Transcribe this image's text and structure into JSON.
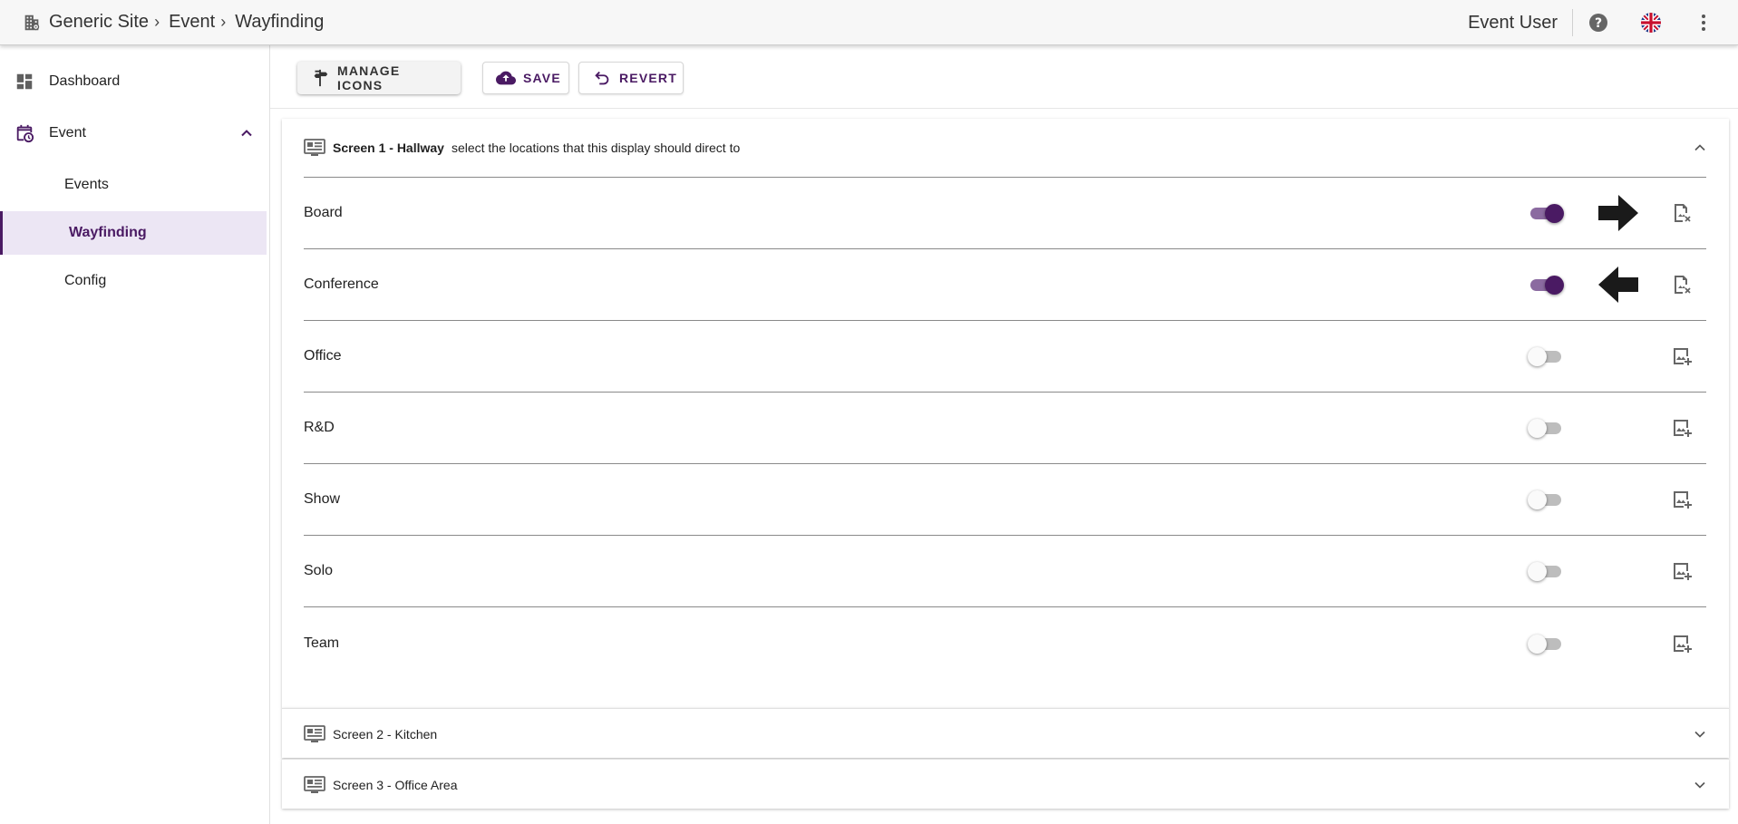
{
  "breadcrumb": {
    "items": [
      "Generic Site",
      "Event",
      "Wayfinding"
    ],
    "separator": "›"
  },
  "header": {
    "user_name": "Event User",
    "help_icon": "help-circle-icon",
    "language_icon": "uk-flag-icon",
    "menu_icon": "more-vert-icon"
  },
  "sidebar": {
    "items": [
      {
        "label": "Dashboard",
        "icon": "dashboard-icon"
      },
      {
        "label": "Event",
        "icon": "calendar-clock-icon",
        "expanded": true
      },
      {
        "label": "Events"
      },
      {
        "label": "Wayfinding",
        "active": true
      },
      {
        "label": "Config"
      }
    ]
  },
  "toolbar": {
    "manage_label": "Manage Icons",
    "save_label": "Save",
    "revert_label": "Revert"
  },
  "panels": [
    {
      "title": "Screen 1 - Hallway",
      "subtitle": "select the locations that this display should direct to",
      "expanded": true,
      "locations": [
        {
          "name": "Board",
          "enabled": true,
          "arrow": "right-arrow-icon",
          "image_action": "remove-image-icon"
        },
        {
          "name": "Conference",
          "enabled": true,
          "arrow": "left-arrow-icon",
          "image_action": "remove-image-icon"
        },
        {
          "name": "Office",
          "enabled": false,
          "image_action": "add-image-icon"
        },
        {
          "name": "R&D",
          "enabled": false,
          "image_action": "add-image-icon"
        },
        {
          "name": "Show",
          "enabled": false,
          "image_action": "add-image-icon"
        },
        {
          "name": "Solo",
          "enabled": false,
          "image_action": "add-image-icon"
        },
        {
          "name": "Team",
          "enabled": false,
          "image_action": "add-image-icon"
        }
      ]
    },
    {
      "title": "Screen 2 - Kitchen",
      "expanded": false
    },
    {
      "title": "Screen 3 - Office Area",
      "expanded": false
    }
  ],
  "colors": {
    "accent": "#4a1a63",
    "toggle_track_on": "#8b6aa0",
    "active_nav_bg": "#ece6f4"
  }
}
